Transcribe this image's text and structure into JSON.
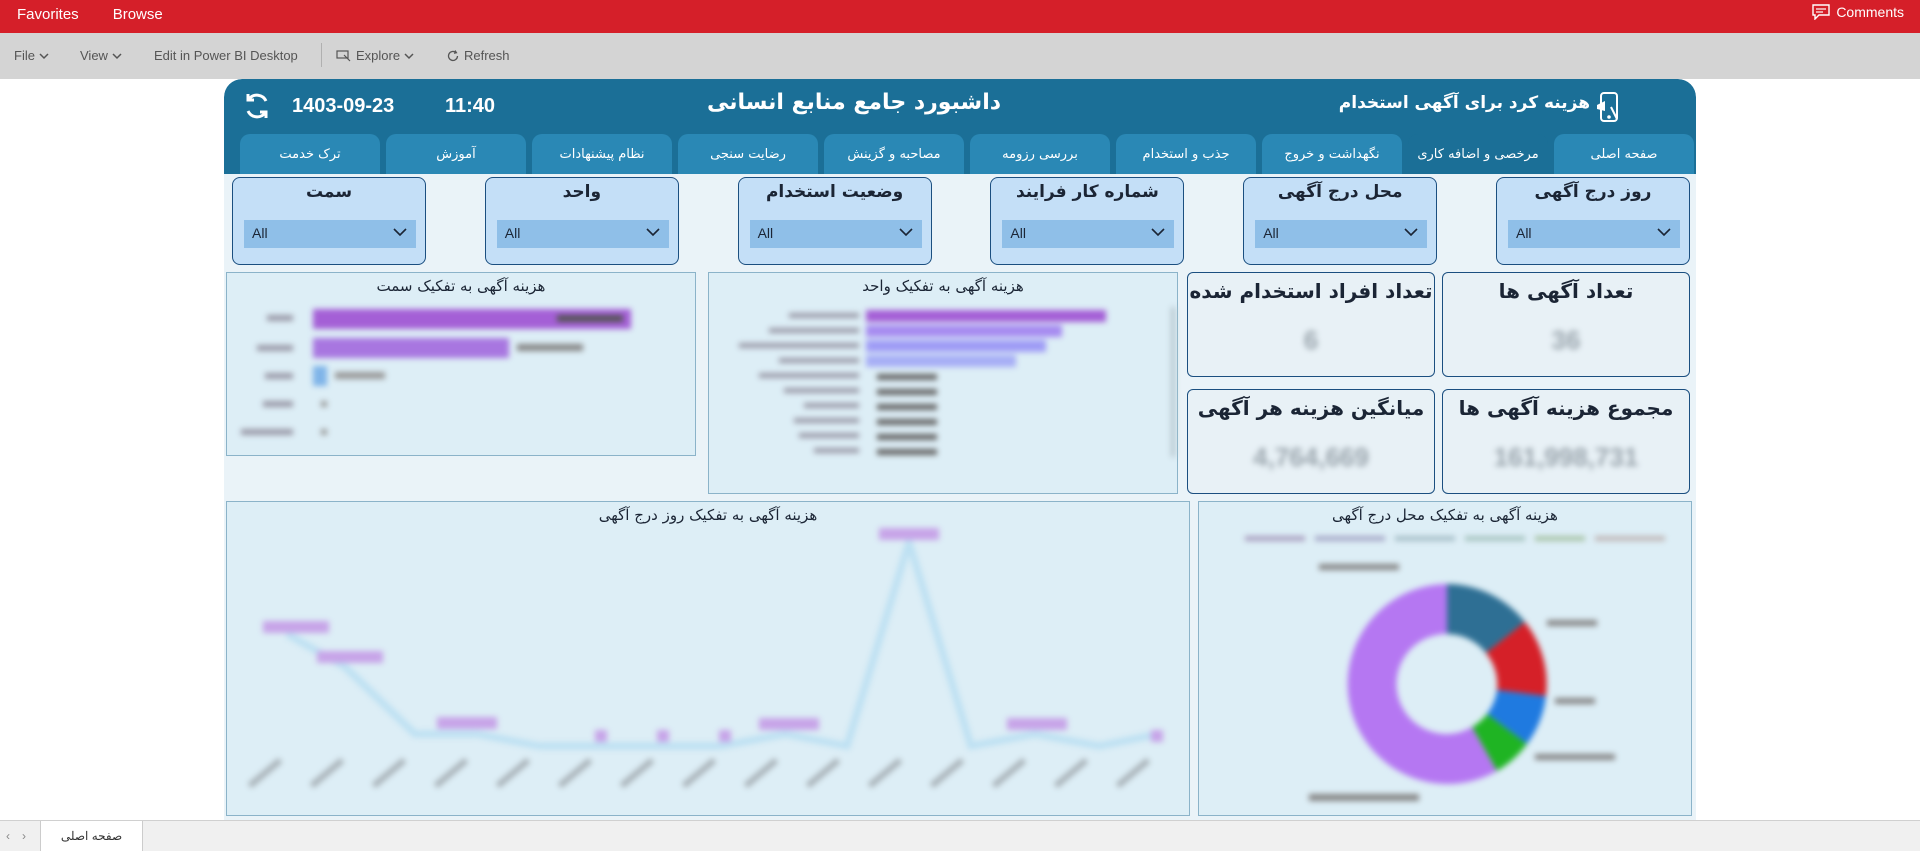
{
  "topbar": {
    "favorites": "Favorites",
    "browse": "Browse",
    "comments": "Comments"
  },
  "toolbar": {
    "file": "File",
    "view": "View",
    "edit": "Edit in Power BI Desktop",
    "explore": "Explore",
    "refresh": "Refresh"
  },
  "header": {
    "date": "1403-09-23",
    "time": "11:40",
    "title": "داشبورد جامع منابع انسانی",
    "subtitle": "هزینه کرد برای آگهی استخدام"
  },
  "tabs": [
    {
      "label": "صفحه اصلی"
    },
    {
      "label": "مرخصی و اضافه کاری"
    },
    {
      "label": "نگهداشت و خروج"
    },
    {
      "label": "جذب و استخدام"
    },
    {
      "label": "بررسی رزومه"
    },
    {
      "label": "مصاحبه و گزینش"
    },
    {
      "label": "رضایت سنجی"
    },
    {
      "label": "نظام پیشنهادات"
    },
    {
      "label": "آموزش"
    },
    {
      "label": "ترک خدمت"
    }
  ],
  "slicers": [
    {
      "title": "روز درج آگهی",
      "value": "All"
    },
    {
      "title": "محل درج آگهی",
      "value": "All"
    },
    {
      "title": "شماره کار فرایند",
      "value": "All"
    },
    {
      "title": "وضعیت استخدام",
      "value": "All"
    },
    {
      "title": "واحد",
      "value": "All"
    },
    {
      "title": "سمت",
      "value": "All"
    }
  ],
  "kpis": {
    "ads_count": {
      "title": "تعداد آگهی ها",
      "value": "36"
    },
    "hired_count": {
      "title": "تعداد افراد استخدام شده",
      "value": "6"
    },
    "total_cost": {
      "title": "مجموع هزینه آگهی ها",
      "value": "161,998,731"
    },
    "avg_cost": {
      "title": "میانگین هزینه هر آگهی",
      "value": "4,764,669"
    }
  },
  "panels": {
    "by_position": "هزینه آگهی به تفکیک سمت",
    "by_unit": "هزینه آگهی به تفکیک واحد",
    "by_day": "هزینه آگهی به تفکیک روز درج آگهی",
    "by_place": "هزینه آگهی به تفکیک محل درج آگهی"
  },
  "colors": {
    "topbar": "#d51f29",
    "header": "#1b6f97",
    "tab": "#2a88b5",
    "slicer": "#c4dff7",
    "bar_purple": "#a45fd6",
    "line": "#bde0f2",
    "donut_purple": "#b577f2",
    "donut_blue": "#2e6f94",
    "donut_red": "#d52028",
    "donut_lightblue": "#1f7ae0",
    "donut_green": "#1fb423"
  },
  "footer": {
    "page_tab": "صفحه اصلی"
  }
}
